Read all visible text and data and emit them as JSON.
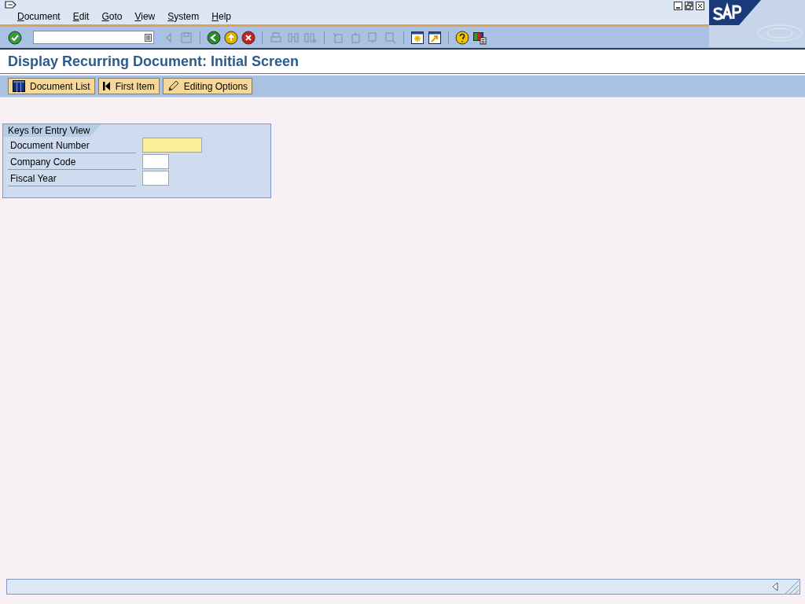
{
  "menu": [
    "Document",
    "Edit",
    "Goto",
    "View",
    "System",
    "Help"
  ],
  "title": "Display Recurring Document: Initial Screen",
  "app_toolbar": [
    {
      "kind": "list",
      "label": "Document List"
    },
    {
      "kind": "first",
      "label": "First Item"
    },
    {
      "kind": "edit",
      "label": "Editing Options"
    }
  ],
  "group": {
    "title": "Keys for Entry View",
    "fields": [
      {
        "label": "Document Number",
        "required": true,
        "kind": "wide"
      },
      {
        "label": "Company Code",
        "required": false,
        "kind": "narrow"
      },
      {
        "label": "Fiscal Year",
        "required": false,
        "kind": "narrow"
      }
    ]
  }
}
